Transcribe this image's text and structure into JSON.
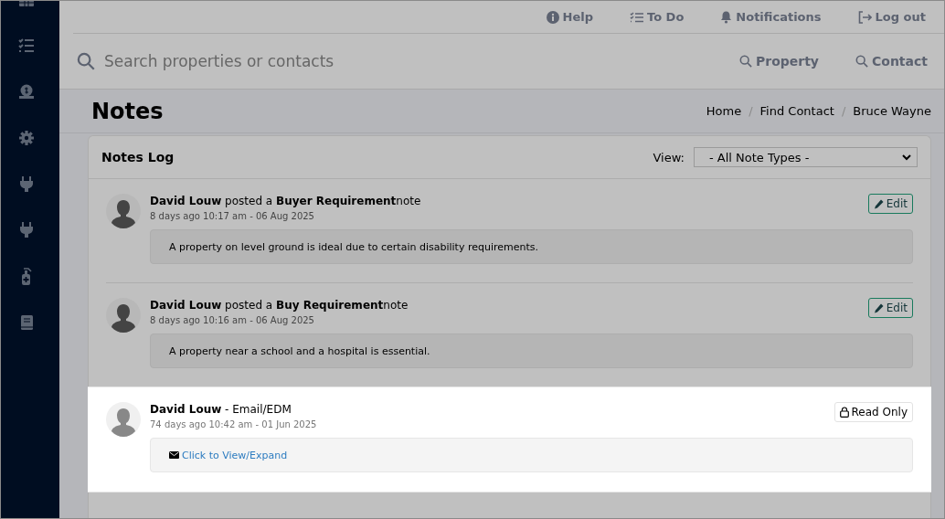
{
  "top_links": [
    {
      "kind": "help",
      "label": "Help"
    },
    {
      "kind": "todo",
      "label": "To Do"
    },
    {
      "kind": "bell",
      "label": "Notifications"
    },
    {
      "kind": "logout",
      "label": "Log out"
    }
  ],
  "search": {
    "placeholder": "Search properties or contacts",
    "buttons": [
      "Property",
      "Contact"
    ]
  },
  "page_title": "Notes",
  "breadcrumb": {
    "items": [
      "Home",
      "Find Contact",
      "Bruce Wayne"
    ],
    "separators": [
      "/",
      "/"
    ]
  },
  "notes_log": {
    "title": "Notes Log",
    "filter": {
      "label": "View:",
      "value": "- All Note Types -"
    },
    "notes": [
      {
        "heading": "**David Louw** posted a **Buyer Requirement**note",
        "meta": "8 days ago 10:17 am - 06 Aug 2025",
        "body": {
          "kind": "text",
          "text": "A property on level ground is ideal due to certain disability requirements."
        },
        "action": {
          "kind": "edit",
          "label": "Edit"
        },
        "highlighted": false
      },
      {
        "heading": "**David Louw** posted a **Buy Requirement**note",
        "meta": "8 days ago 10:16 am - 06 Aug 2025",
        "body": {
          "kind": "text",
          "text": "A property near a school and a hospital is essential."
        },
        "action": {
          "kind": "edit",
          "label": "Edit"
        },
        "highlighted": false
      },
      {
        "heading": "**David Louw** - Email/EDM",
        "meta": "74 days ago 10:42 am - 01 Jun 2025",
        "body": {
          "kind": "link",
          "text": "Click to View/Expand"
        },
        "action": {
          "kind": "read_only",
          "label": "Read Only"
        },
        "highlighted": true
      }
    ]
  }
}
